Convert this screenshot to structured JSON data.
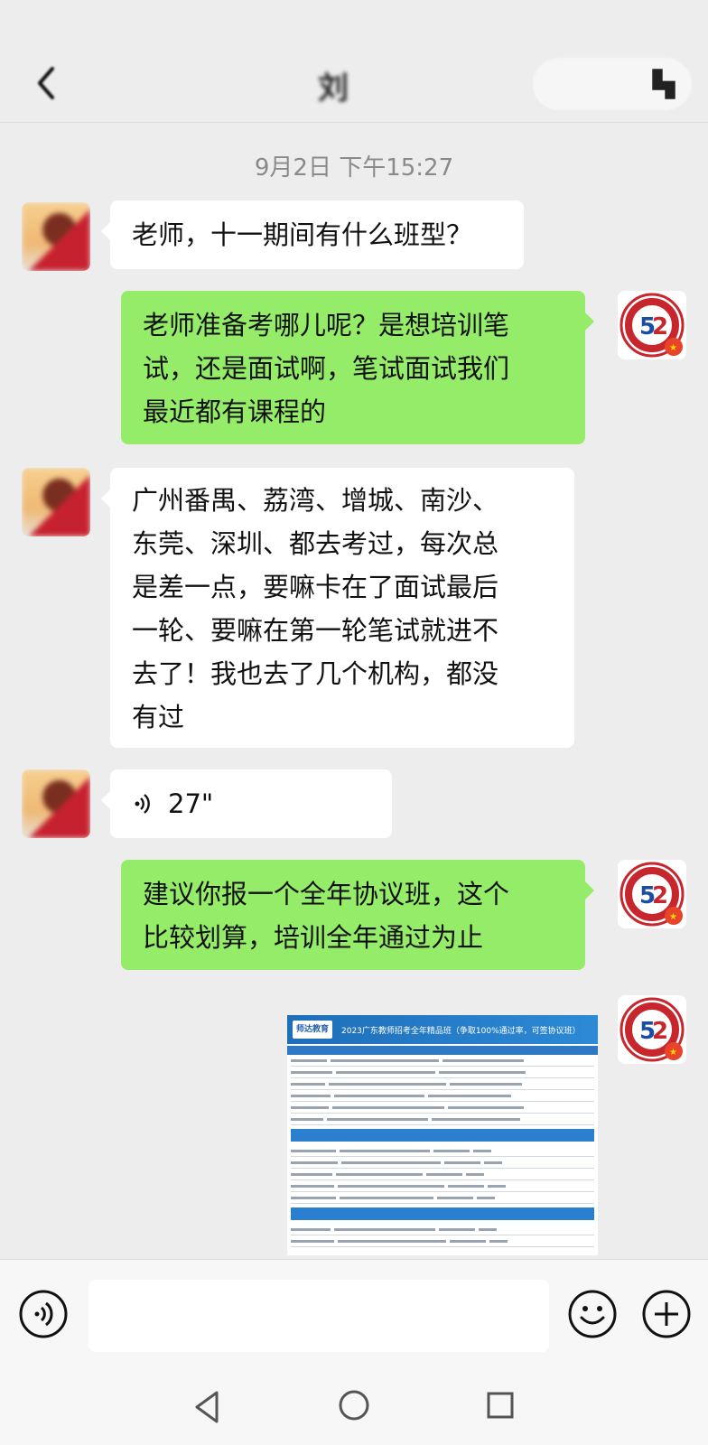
{
  "header": {
    "title": "刘",
    "back_icon": "back-arrow-icon",
    "more_icon": "more-icon"
  },
  "timestamp": "9月2日 下午15:27",
  "messages": [
    {
      "side": "left",
      "type": "text",
      "text": "老师，十一期间有什么班型？"
    },
    {
      "side": "right",
      "type": "text",
      "lines": [
        "老师准备考哪儿呢？是想培训笔",
        "试，还是面试啊，笔试面试我们",
        "最近都有课程的"
      ]
    },
    {
      "side": "left",
      "type": "text",
      "lines": [
        "广州番禺、荔湾、增城、南沙、",
        "东莞、深圳、都去考过，每次总",
        "是差一点，要嘛卡在了面试最后",
        "一轮、要嘛在第一轮笔试就进不",
        "去了！我也去了几个机构，都没",
        "有过"
      ]
    },
    {
      "side": "left",
      "type": "voice",
      "duration": "27\""
    },
    {
      "side": "right",
      "type": "text",
      "lines": [
        "建议你报一个全年协议班，这个",
        "比较划算，培训全年通过为止"
      ]
    },
    {
      "side": "right",
      "type": "image",
      "image_title": "2023广东教师招考全年精品班（争取100%通过率，可签协议班）",
      "logo_text": "师达教育"
    }
  ],
  "input_bar": {
    "voice_icon": "voice-input-icon",
    "emoji_icon": "emoji-icon",
    "plus_icon": "plus-icon"
  },
  "nav": {
    "back_icon": "nav-back-icon",
    "home_icon": "nav-home-icon",
    "recent_icon": "nav-recent-icon"
  },
  "colors": {
    "background": "#ededed",
    "bubble_sent": "#95ec69",
    "bubble_received": "#ffffff",
    "timestamp": "#8a8a8a"
  }
}
